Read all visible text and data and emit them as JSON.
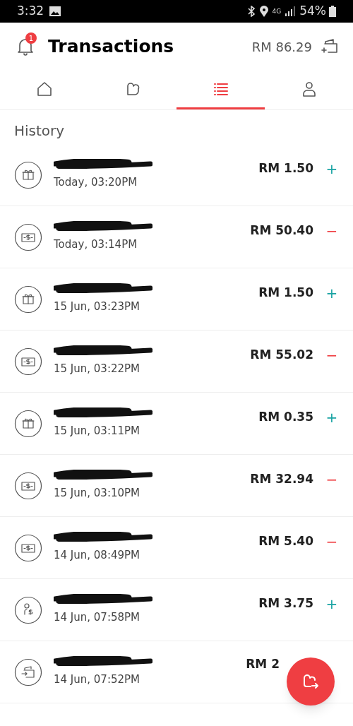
{
  "status_bar": {
    "time": "3:32",
    "network": "4G",
    "battery": "54%"
  },
  "header": {
    "title": "Transactions",
    "notification_count": "1",
    "balance": "RM 86.29"
  },
  "tabs": [
    {
      "kind": "home",
      "selected": false
    },
    {
      "kind": "pocket",
      "selected": false
    },
    {
      "kind": "list",
      "selected": true
    },
    {
      "kind": "profile",
      "selected": false
    }
  ],
  "section_title": "History",
  "transactions": [
    {
      "kind": "gift",
      "time": "Today, 03:20PM",
      "amount": "RM 1.50",
      "credit": true,
      "sign": "+"
    },
    {
      "kind": "cash",
      "time": "Today, 03:14PM",
      "amount": "RM 50.40",
      "credit": false,
      "sign": "−"
    },
    {
      "kind": "gift",
      "time": "15 Jun, 03:23PM",
      "amount": "RM 1.50",
      "credit": true,
      "sign": "+"
    },
    {
      "kind": "cash",
      "time": "15 Jun, 03:22PM",
      "amount": "RM 55.02",
      "credit": false,
      "sign": "−"
    },
    {
      "kind": "gift",
      "time": "15 Jun, 03:11PM",
      "amount": "RM 0.35",
      "credit": true,
      "sign": "+"
    },
    {
      "kind": "cash",
      "time": "15 Jun, 03:10PM",
      "amount": "RM 32.94",
      "credit": false,
      "sign": "−"
    },
    {
      "kind": "cash",
      "time": "14 Jun, 08:49PM",
      "amount": "RM 5.40",
      "credit": false,
      "sign": "−"
    },
    {
      "kind": "person",
      "time": "14 Jun, 07:58PM",
      "amount": "RM 3.75",
      "credit": true,
      "sign": "+"
    },
    {
      "kind": "wallet",
      "time": "14 Jun, 07:52PM",
      "amount": "RM 2"
    }
  ]
}
